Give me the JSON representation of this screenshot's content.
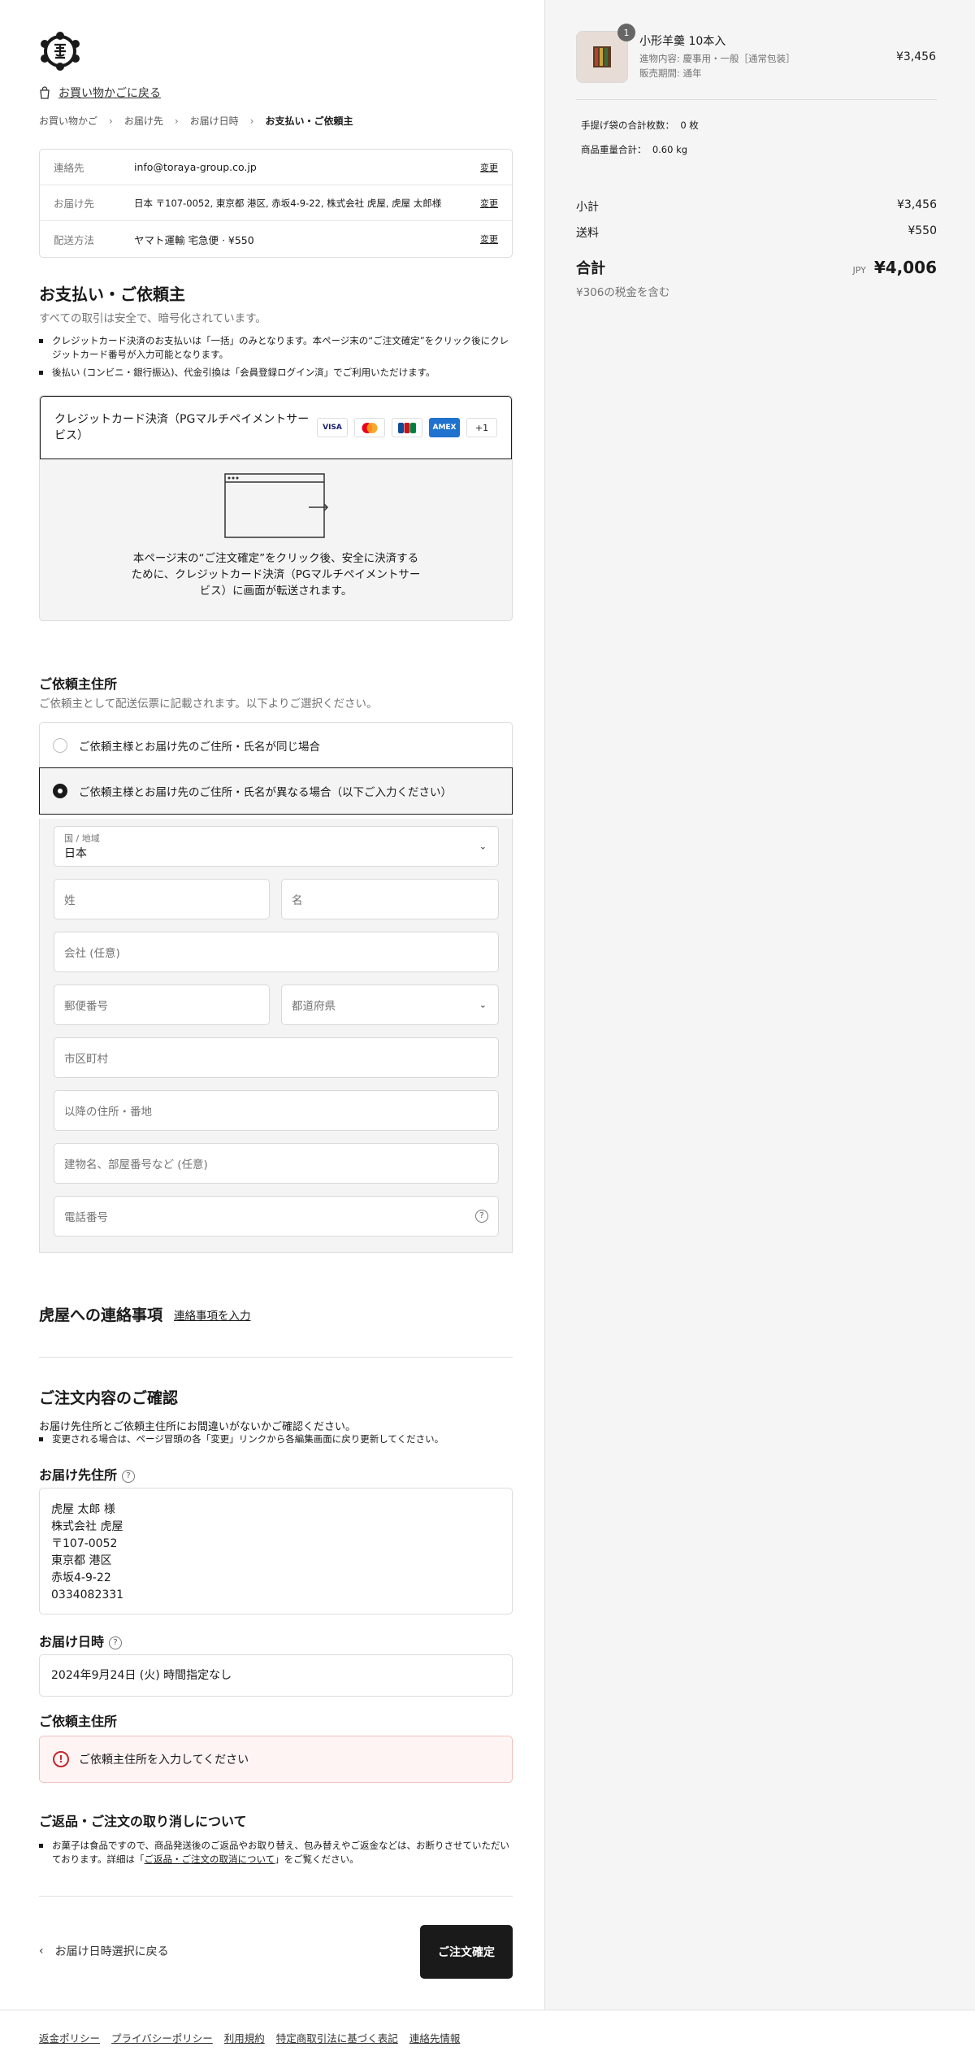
{
  "header": {
    "back_to_cart": "お買い物かごに戻る"
  },
  "breadcrumb": [
    "お買い物かご",
    "お届け先",
    "お届け日時",
    "お支払い・ご依頼主"
  ],
  "summary": [
    {
      "label": "連絡先",
      "value": "info@toraya-group.co.jp",
      "change": "変更"
    },
    {
      "label": "お届け先",
      "value": "日本 〒107-0052, 東京都 港区, 赤坂4-9-22, 株式会社 虎屋, 虎屋 太郎様",
      "change": "変更"
    },
    {
      "label": "配送方法",
      "value": "ヤマト運輸 宅急便 · ¥550",
      "change": "変更"
    }
  ],
  "payment": {
    "title": "お支払い・ご依頼主",
    "subtitle": "すべての取引は安全で、暗号化されています。",
    "notes": [
      "クレジットカード決済のお支払いは「一括」のみとなります。本ページ末の“ご注文確定”をクリック後にクレジットカード番号が入力可能となります。",
      "後払い (コンビニ・銀行振込)、代金引換は「会員登録ログイン済」でご利用いただけます。"
    ],
    "method_label": "クレジットカード決済（PGマルチペイメントサービス）",
    "cards": [
      "VISA",
      "MC",
      "JCB",
      "AMEX",
      "+1"
    ],
    "redirect_text": "本ページ末の“ご注文確定”をクリック後、安全に決済するために、クレジットカード決済（PGマルチペイメントサービス）に画面が転送されます。"
  },
  "sender": {
    "title": "ご依頼主住所",
    "subtitle": "ご依頼主として配送伝票に記載されます。以下よりご選択ください。",
    "option_same": "ご依頼主様とお届け先のご住所・氏名が同じ場合",
    "option_diff": "ご依頼主様とお届け先のご住所・氏名が異なる場合（以下ご入力ください）",
    "country_label": "国 / 地域",
    "country_value": "日本",
    "placeholders": {
      "last_name": "姓",
      "first_name": "名",
      "company": "会社 (任意)",
      "postal": "郵便番号",
      "prefecture": "都道府県",
      "city": "市区町村",
      "address": "以降の住所・番地",
      "building": "建物名、部屋番号など (任意)",
      "phone": "電話番号"
    }
  },
  "notes_section": {
    "title": "虎屋への連絡事項",
    "link": "連絡事項を入力"
  },
  "confirm": {
    "title": "ご注文内容のご確認",
    "desc": "お届け先住所とご依頼主住所にお間違いがないかご確認ください。",
    "note": "変更される場合は、ページ冒頭の各「変更」リンクから各編集画面に戻り更新してください。",
    "ship_title": "お届け先住所",
    "ship_lines": [
      "虎屋 太郎 様",
      "株式会社 虎屋",
      "〒107-0052",
      "東京都 港区",
      "赤坂4-9-22",
      "0334082331"
    ],
    "date_title": "お届け日時",
    "date_value": "2024年9月24日 (火) 時間指定なし",
    "sender_title": "ご依頼主住所",
    "sender_error": "ご依頼主住所を入力してください"
  },
  "returns": {
    "title": "ご返品・ご注文の取り消しについて",
    "text_before": "お菓子は食品ですので、商品発送後のご返品やお取り替え、包み替えやご返金などは、お断りさせていただいております。詳細は「",
    "link": "ご返品・ご注文の取消について",
    "text_after": "」をご覧ください。"
  },
  "actions": {
    "back": "お届け日時選択に戻る",
    "submit": "ご注文確定"
  },
  "footer": [
    "返金ポリシー",
    "プライバシーポリシー",
    "利用規約",
    "特定商取引法に基づく表記",
    "連絡先情報"
  ],
  "cart": {
    "qty": "1",
    "name": "小形羊羹 10本入",
    "detail1": "進物内容: 慶事用・一般［通常包装］",
    "detail2": "販売期間: 通年",
    "price": "¥3,456",
    "bag_count_label": "手提げ袋の合計枚数：",
    "bag_count_value": "0 枚",
    "weight_label": "商品重量合計：",
    "weight_value": "0.60 kg",
    "subtotal_label": "小計",
    "subtotal_value": "¥3,456",
    "shipping_label": "送料",
    "shipping_value": "¥550",
    "total_label": "合計",
    "currency": "JPY",
    "total_value": "¥4,006",
    "tax_note": "¥306の税金を含む"
  }
}
